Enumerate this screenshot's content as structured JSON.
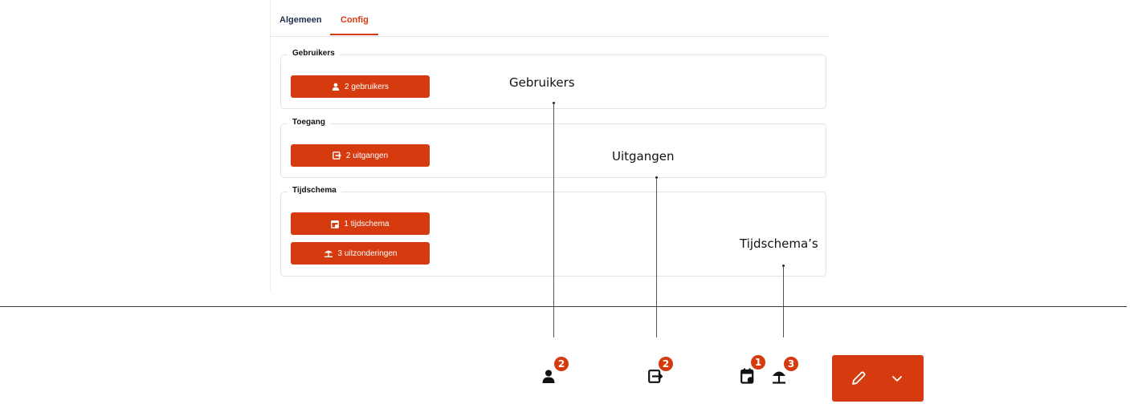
{
  "tabs": [
    {
      "label": "Algemeen"
    },
    {
      "label": "Config"
    }
  ],
  "sections": {
    "users": {
      "title": "Gebruikers",
      "button": "2 gebruikers"
    },
    "access": {
      "title": "Toegang",
      "button": "2 uitgangen"
    },
    "schedule": {
      "title": "Tijdschema",
      "buttons": [
        "1 tijdschema",
        "3 uitzonderingen"
      ]
    }
  },
  "callouts": {
    "users": "Gebruikers",
    "exits": "Uitgangen",
    "schedules": "Tijdschema’s"
  },
  "badges": {
    "users": "2",
    "exits": "2",
    "schedule": "1",
    "exceptions": "3"
  },
  "icons": [
    "user-icon",
    "exit-icon",
    "calendar-icon",
    "beach-umbrella-icon",
    "pencil-icon",
    "chevron-down-icon"
  ],
  "colors": {
    "accent": "#d63a0f",
    "tab_inactive": "#1f2f4d"
  }
}
